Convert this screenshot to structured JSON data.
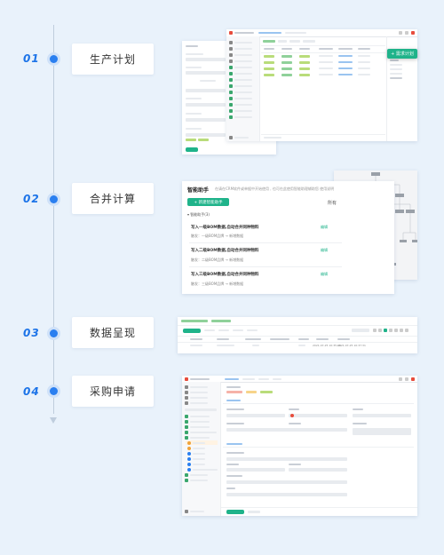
{
  "steps": [
    {
      "num": "01",
      "label": "生产计划"
    },
    {
      "num": "02",
      "label": "合并计算"
    },
    {
      "num": "03",
      "label": "数据呈现"
    },
    {
      "num": "04",
      "label": "采购申请"
    }
  ],
  "screen1": {
    "popup_button": "+ 需求计划"
  },
  "screen2": {
    "title": "智能助手",
    "description": "在请在CRM软件或单据中开始使用 , 也可在此使用智能助理辅助您  使用说明",
    "new_button": "+ 新建智能助手",
    "all_label": "所有",
    "group_label": "智能助手(3)",
    "items": [
      {
        "title": "写入一级BOM数据,自动合并同种物料",
        "sub": "触发：一级BOM品牌 → 新增数据",
        "action": "编辑"
      },
      {
        "title": "写入二级BOM数据,自动合并同种物料",
        "sub": "触发：二级BOM品牌 → 新增数据",
        "action": "编辑"
      },
      {
        "title": "写入三级BOM数据,自动合并同种物料",
        "sub": "触发：三级BOM品牌 → 新增数据",
        "action": "编辑"
      }
    ]
  },
  "screen3": {
    "row_values": [
      "2021-07-25 10:35:46",
      "2021-07-25 10:37:31"
    ]
  },
  "screen4": {}
}
